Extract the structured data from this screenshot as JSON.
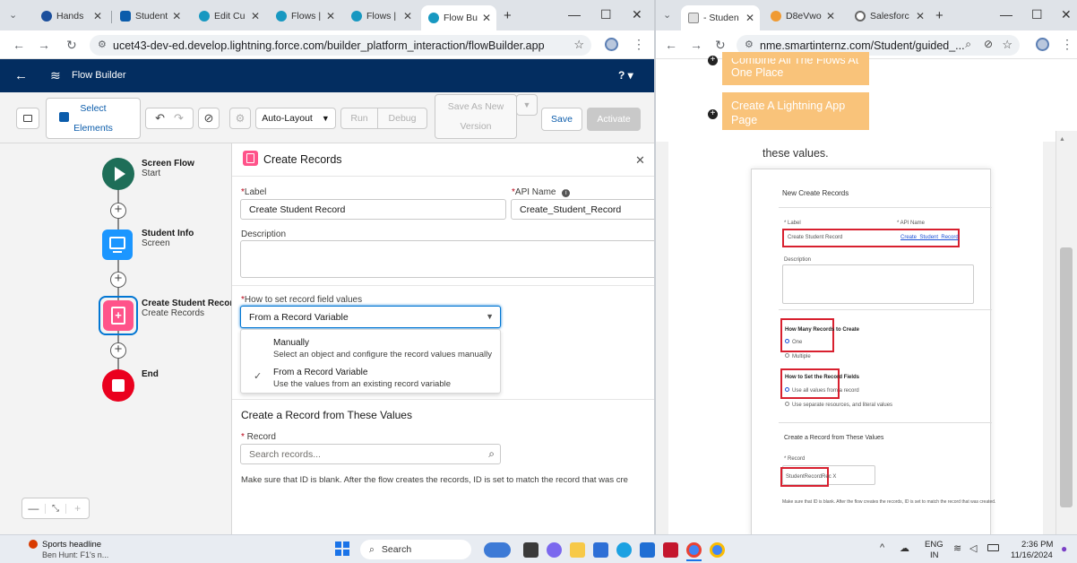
{
  "left_browser": {
    "tabs": [
      {
        "label": "Hands"
      },
      {
        "label": "Student"
      },
      {
        "label": "Edit Cu"
      },
      {
        "label": "Flows |"
      },
      {
        "label": "Flows |"
      },
      {
        "label": "Flow Bu"
      }
    ],
    "url": "ucet43-dev-ed.develop.lightning.force.com/builder_platform_interaction/flowBuilder.app"
  },
  "flow_builder": {
    "app_title": "Flow Builder",
    "help": "?",
    "toolbar": {
      "select_elements": "Select Elements",
      "select_line1": "Select",
      "select_line2": "Elements",
      "auto_layout": "Auto-Layout",
      "run": "Run",
      "debug": "Debug",
      "save_as_new_line1": "Save As New",
      "save_as_new_line2": "Version",
      "save": "Save",
      "activate": "Activate"
    },
    "canvas": {
      "start": {
        "title": "Screen Flow",
        "sub": "Start"
      },
      "screen": {
        "title": "Student Info",
        "sub": "Screen"
      },
      "create": {
        "title": "Create Student Recor",
        "sub": "Create Records"
      },
      "end": {
        "title": "End"
      }
    },
    "panel": {
      "title": "Create Records",
      "label_label": "Label",
      "label_value": "Create Student Record",
      "api_label": "API Name",
      "api_value": "Create_Student_Record",
      "description_label": "Description",
      "how_label": "How to set record field values",
      "how_value": "From a Record Variable",
      "options": [
        {
          "title": "Manually",
          "desc": "Select an object and configure the record values manually"
        },
        {
          "title": "From a Record Variable",
          "desc": "Use the values from an existing record variable"
        }
      ],
      "section_title": "Create a Record from These Values",
      "record_label": "Record",
      "record_placeholder": "Search records...",
      "help_text": "Make sure that ID is blank. After the flow creates the records, ID is set to match the record that was cre"
    }
  },
  "right_browser": {
    "tabs": [
      {
        "label": "- Studen"
      },
      {
        "label": "D8eVwo"
      },
      {
        "label": "Salesforc"
      }
    ],
    "url": "nme.smartinternz.com/Student/guided_..."
  },
  "guide_page": {
    "cards": [
      {
        "text_line1": "Combine All The Flows At",
        "text_line2": "One Place"
      },
      {
        "text_line1": "Create A Lightning App",
        "text_line2": "Page"
      }
    ],
    "body_text": "these values.",
    "screenshot": {
      "title": "New Create Records",
      "label": "* Label",
      "api": "* API Name",
      "label_value": "Create Student Record",
      "api_value": "Create_Student_Record",
      "description": "Description",
      "how_many": "How Many Records to Create",
      "one": "One",
      "multiple": "Multiple",
      "how_set": "How to Set the Record Fields",
      "opt_all": "Use all values from a record",
      "opt_sep": "Use separate resources, and literal values",
      "section": "Create a Record from These Values",
      "record": "* Record",
      "record_value": "StudentRecordRec X",
      "note": "Make sure that ID is blank. After the flow creates the records, ID is set to match the record that was created."
    }
  },
  "taskbar": {
    "news_title": "Sports headline",
    "news_sub": "Ben Hunt: F1's n...",
    "search": "Search",
    "lang": "ENG",
    "region": "IN",
    "time": "2:36 PM",
    "date": "11/16/2024"
  },
  "colors": {
    "sf_header": "#032d60",
    "sf_brand": "#0176d3",
    "start_green": "#1e6e58",
    "screen_blue": "#1b96ff",
    "create_pink": "#ff538a",
    "end_red": "#ea001e",
    "guide_orange": "#f9c37a",
    "highlight_red": "#d8202f"
  }
}
